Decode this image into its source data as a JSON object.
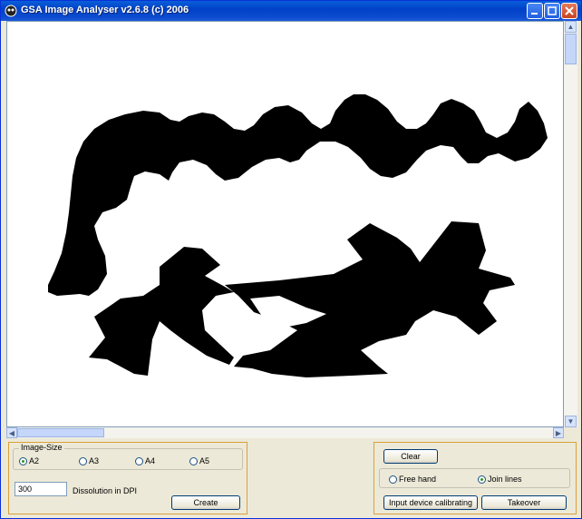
{
  "window": {
    "title": "GSA Image Analyser v2.6.8 (c) 2006",
    "minimize_label": "minimize",
    "maximize_label": "maximize",
    "close_label": "close"
  },
  "image_size": {
    "legend": "Image-Size",
    "options": [
      {
        "label": "A2",
        "selected": true
      },
      {
        "label": "A3",
        "selected": false
      },
      {
        "label": "A4",
        "selected": false
      },
      {
        "label": "A5",
        "selected": false
      }
    ]
  },
  "resolution": {
    "value": "300",
    "label": "Dissolution in DPI",
    "create_label": "Create"
  },
  "draw": {
    "clear_label": "Clear",
    "modes": [
      {
        "label": "Free hand",
        "selected": false
      },
      {
        "label": "Join lines",
        "selected": true
      }
    ],
    "calibrate_label": "Input device calibrating",
    "takeover_label": "Takeover"
  }
}
